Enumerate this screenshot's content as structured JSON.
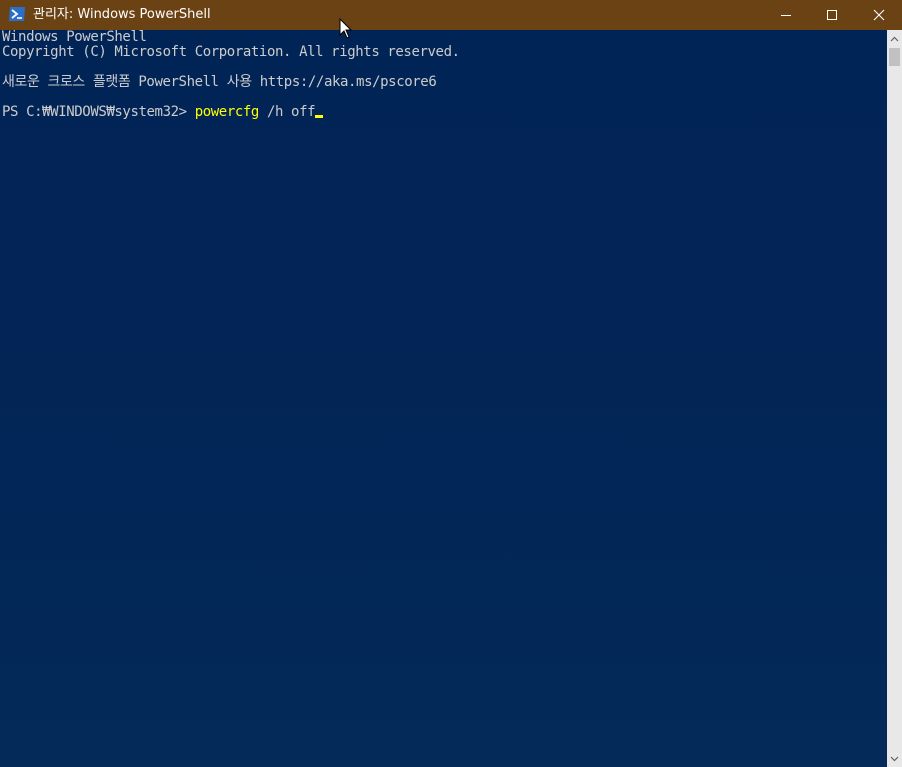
{
  "window": {
    "title": "관리자: Windows PowerShell",
    "icon": "powershell-icon",
    "titlebar_color": "#6b4213",
    "console_bg": "#012456",
    "controls": {
      "minimize": "minimize-icon",
      "maximize": "maximize-icon",
      "close": "close-icon"
    }
  },
  "console": {
    "lines": [
      "Windows PowerShell",
      "Copyright (C) Microsoft Corporation. All rights reserved.",
      "새로운 크로스 플랫폼 PowerShell 사용 https://aka.ms/pscore6"
    ],
    "prompt": {
      "prefix": "PS C:₩WINDOWS₩system32> ",
      "command": "powercfg",
      "arguments": " /h off"
    },
    "text_color": "#cccccc",
    "command_color": "#ffff00"
  }
}
